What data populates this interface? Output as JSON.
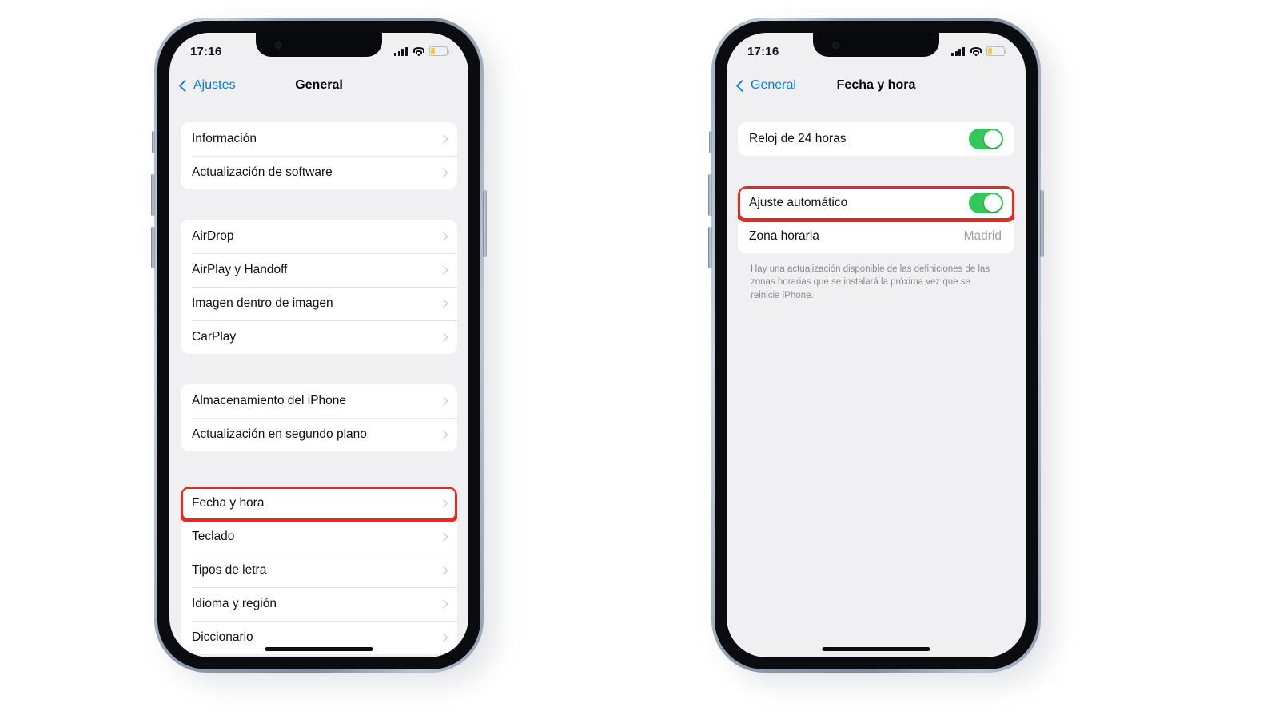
{
  "phones": [
    {
      "id": "phone-general",
      "status_bar": {
        "time": "17:16",
        "signal": "signal-bars-icon",
        "wifi": "wifi-icon",
        "battery": "battery-low-icon",
        "battery_percent": 25
      },
      "nav": {
        "back_label": "Ajustes",
        "title": "General"
      },
      "groups": [
        {
          "rows": [
            {
              "label": "Información",
              "type": "link"
            },
            {
              "label": "Actualización de software",
              "type": "link"
            }
          ]
        },
        {
          "rows": [
            {
              "label": "AirDrop",
              "type": "link"
            },
            {
              "label": "AirPlay y Handoff",
              "type": "link"
            },
            {
              "label": "Imagen dentro de imagen",
              "type": "link"
            },
            {
              "label": "CarPlay",
              "type": "link"
            }
          ]
        },
        {
          "rows": [
            {
              "label": "Almacenamiento del iPhone",
              "type": "link"
            },
            {
              "label": "Actualización en segundo plano",
              "type": "link"
            }
          ]
        },
        {
          "rows": [
            {
              "label": "Fecha y hora",
              "type": "link",
              "highlighted": true
            },
            {
              "label": "Teclado",
              "type": "link"
            },
            {
              "label": "Tipos de letra",
              "type": "link"
            },
            {
              "label": "Idioma y región",
              "type": "link"
            },
            {
              "label": "Diccionario",
              "type": "link"
            }
          ]
        }
      ]
    },
    {
      "id": "phone-fecha-hora",
      "status_bar": {
        "time": "17:16",
        "signal": "signal-bars-icon",
        "wifi": "wifi-icon",
        "battery": "battery-low-icon",
        "battery_percent": 25
      },
      "nav": {
        "back_label": "General",
        "title": "Fecha y hora"
      },
      "groups": [
        {
          "rows": [
            {
              "label": "Reloj de 24 horas",
              "type": "toggle",
              "on": true
            }
          ]
        },
        {
          "rows": [
            {
              "label": "Ajuste automático",
              "type": "toggle",
              "on": true,
              "highlighted": true
            },
            {
              "label": "Zona horaria",
              "type": "value",
              "value": "Madrid"
            }
          ],
          "footnote": "Hay una actualización disponible de las definiciones de las zonas horarias que se instalará la próxima vez que se reinicie iPhone."
        }
      ]
    }
  ],
  "colors": {
    "accent_blue": "#0a78e8",
    "toggle_green": "#34c759",
    "highlight_red": "#e8291f",
    "background": "#f0f0f3",
    "card": "#ffffff",
    "battery_yellow": "#f5c73e"
  }
}
